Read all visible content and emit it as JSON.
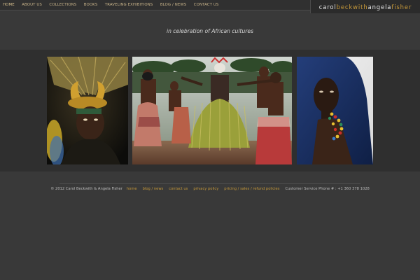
{
  "nav": {
    "items": [
      {
        "label": "HOME"
      },
      {
        "label": "ABOUT US"
      },
      {
        "label": "COLLECTIONS"
      },
      {
        "label": "BOOKS"
      },
      {
        "label": "TRAVELING EXHIBITIONS"
      },
      {
        "label": "BLOG / NEWS"
      },
      {
        "label": "CONTACT US"
      }
    ]
  },
  "brand": {
    "part1": "carol ",
    "part2": "beckwith",
    "part3": " angela",
    "part4": "fisher"
  },
  "tagline": "in celebration of African cultures",
  "gallery": {
    "photos": [
      {
        "icon": "photo-masked-headdress"
      },
      {
        "icon": "photo-ceremonial-dance"
      },
      {
        "icon": "photo-woman-in-blue-shawl"
      }
    ]
  },
  "footer": {
    "copyright": "© 2012 Carol Beckwith & Angela Fisher",
    "links": [
      {
        "label": "home"
      },
      {
        "label": "blog / news"
      },
      {
        "label": "contact us"
      },
      {
        "label": "privacy policy"
      },
      {
        "label": "pricing / sales / refund policies"
      }
    ],
    "phone": "Customer Service Phone # : +1 360 378 1028"
  },
  "colors": {
    "accent": "#c89a3a",
    "nav_text": "#c9b48a",
    "background": "#393939",
    "band": "#2f2f2f"
  }
}
